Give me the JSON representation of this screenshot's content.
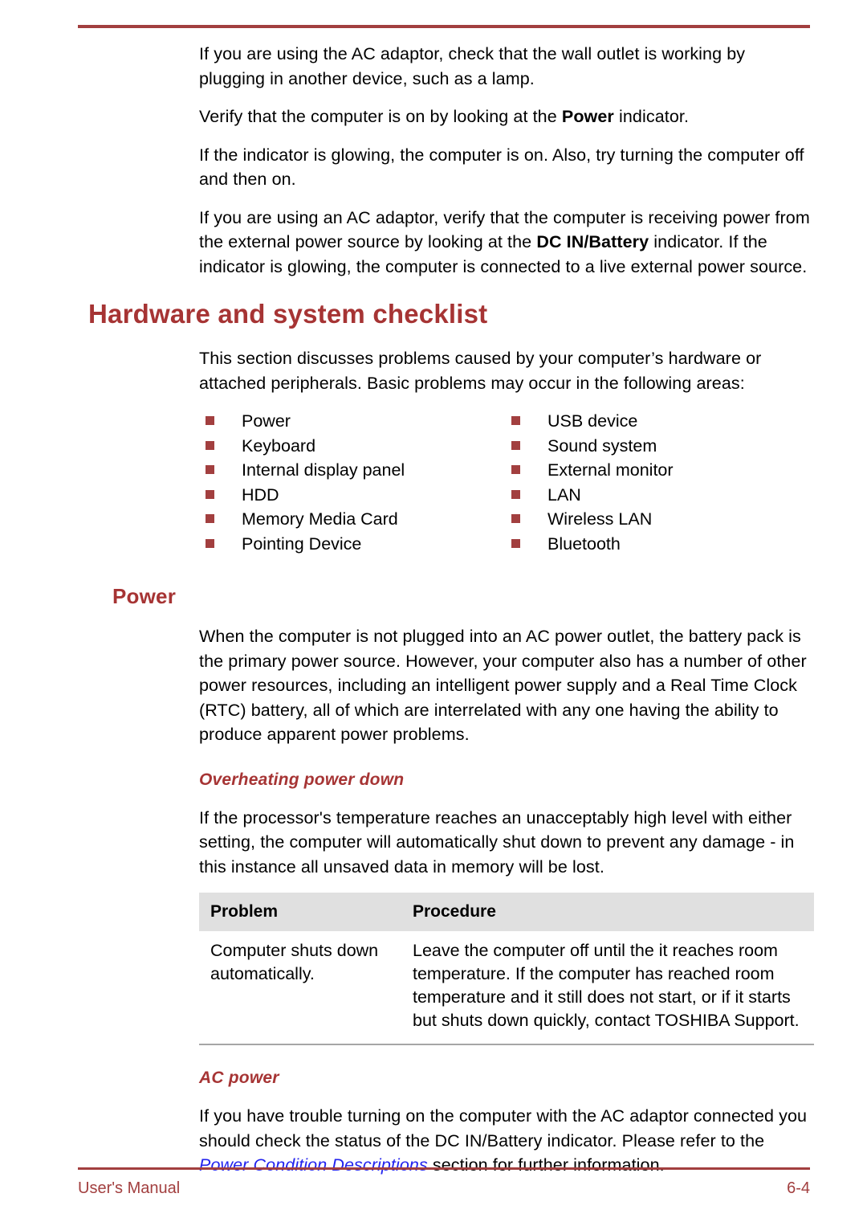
{
  "page": {
    "accent_color": "#a63434",
    "rule_color": "#a23f3f",
    "link_color": "#2222ee",
    "table_header_bg": "#e0e0e0"
  },
  "intro_paragraphs": [
    {
      "segments": [
        {
          "text": "If you are using the AC adaptor, check that the wall outlet is working by plugging in another device, such as a lamp.",
          "style": "normal"
        }
      ]
    },
    {
      "segments": [
        {
          "text": "Verify that the computer is on by looking at the ",
          "style": "normal"
        },
        {
          "text": "Power",
          "style": "bold"
        },
        {
          "text": " indicator.",
          "style": "normal"
        }
      ]
    },
    {
      "segments": [
        {
          "text": "If the indicator is glowing, the computer is on. Also, try turning the computer off and then on.",
          "style": "normal"
        }
      ]
    },
    {
      "segments": [
        {
          "text": "If you are using an AC adaptor, verify that the computer is receiving power from the external power source by looking at the ",
          "style": "normal"
        },
        {
          "text": "DC IN/Battery",
          "style": "bold"
        },
        {
          "text": " indicator. If the indicator is glowing, the computer is connected to a live external power source.",
          "style": "normal"
        }
      ]
    }
  ],
  "section": {
    "heading": "Hardware and system checklist",
    "intro": "This section discusses problems caused by your computer’s hardware or attached peripherals. Basic problems may occur in the following areas:",
    "checklist": {
      "left_column": [
        "Power",
        "Keyboard",
        "Internal display panel",
        "HDD",
        "Memory Media Card",
        "Pointing Device"
      ],
      "right_column": [
        "USB device",
        "Sound system",
        "External monitor",
        "LAN",
        "Wireless LAN",
        "Bluetooth"
      ]
    }
  },
  "power_section": {
    "heading": "Power",
    "paragraph": "When the computer is not plugged into an AC power outlet, the battery pack is the primary power source. However, your computer also has a number of other power resources, including an intelligent power supply and a Real Time Clock (RTC) battery, all of which are interrelated with any one having the ability to produce apparent power problems."
  },
  "overheating": {
    "heading": "Overheating power down",
    "paragraph": "If the processor's temperature reaches an unacceptably high level with either setting, the computer will automatically shut down to prevent any damage - in this instance all unsaved data in memory will be lost.",
    "table": {
      "columns": [
        "Problem",
        "Procedure"
      ],
      "rows": [
        {
          "problem": "Computer shuts down automatically.",
          "procedure": "Leave the computer off until the it reaches room temperature. If the computer has reached room temperature and it still does not start, or if it starts but shuts down quickly, contact TOSHIBA Support."
        }
      ]
    }
  },
  "ac_power": {
    "heading": "AC power",
    "paragraph_before": "If you have trouble turning on the computer with the AC adaptor connected you should check the status of the DC IN/Battery indicator. Please refer to the ",
    "link_text": "Power Condition Descriptions",
    "paragraph_after": " section for further information."
  },
  "footer": {
    "left": "User's Manual",
    "right": "6-4"
  }
}
